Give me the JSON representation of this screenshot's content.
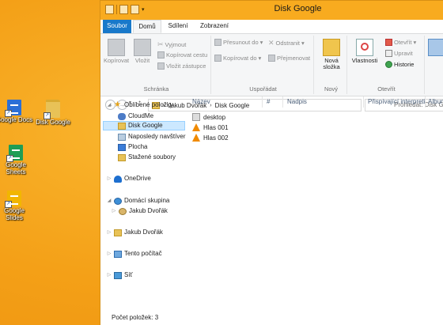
{
  "desktop": {
    "icons": [
      {
        "label": "Google Docs",
        "icon": "google-docs-icon"
      },
      {
        "label": "Disk Google",
        "icon": "folder-icon"
      },
      {
        "label": "Google Sheets",
        "icon": "google-sheets-icon"
      },
      {
        "label": "Google Slides",
        "icon": "google-slides-icon"
      }
    ]
  },
  "window": {
    "title": "Disk Google",
    "tabs": {
      "file": "Soubor",
      "home": "Domů",
      "share": "Sdílení",
      "view": "Zobrazení"
    }
  },
  "ribbon": {
    "clipboard": {
      "copy": "Kopírovat",
      "paste": "Vložit",
      "cut": "Vyjmout",
      "copy_path": "Kopírovat cestu",
      "paste_shortcut": "Vložit zástupce",
      "label": "Schránka"
    },
    "organize": {
      "move_to": "Přesunout do",
      "copy_to": "Kopírovat do",
      "delete": "Odstranit",
      "rename": "Přejmenovat",
      "label": "Uspořádat"
    },
    "new": {
      "new_folder_line1": "Nová",
      "new_folder_line2": "složka",
      "label": "Nový"
    },
    "open": {
      "properties": "Vlastnosti",
      "open": "Otevřít",
      "edit": "Upravit",
      "history": "Historie",
      "label": "Otevřít"
    }
  },
  "navigation": {
    "address": {
      "user": "Jakub Dvořák",
      "folder": "Disk Google"
    },
    "search_placeholder": "Prohledat: Disk Google"
  },
  "sidebar": {
    "favorites": "Oblíbené položky",
    "fav_items": [
      "CloudMe",
      "Disk Google",
      "Naposledy navštíver",
      "Plocha",
      "Stažené soubory"
    ],
    "onedrive": "OneDrive",
    "homegroup": "Domácí skupina",
    "homegroup_user": "Jakub Dvořák",
    "user": "Jakub Dvořák",
    "this_pc": "Tento počítač",
    "network": "Síť"
  },
  "columns": {
    "name": "Název",
    "number": "#",
    "title": "Nadpis",
    "artists": "Přispívající interpreti",
    "album": "Album"
  },
  "files": [
    "desktop",
    "Hlas 001",
    "Hlas 002"
  ],
  "status": {
    "count": "Počet položek: 3"
  },
  "colors": {
    "accent": "#1979ca",
    "titlebar": "#f8ab1f",
    "desktop": "#f4a017",
    "selection": "#cce8ff"
  }
}
